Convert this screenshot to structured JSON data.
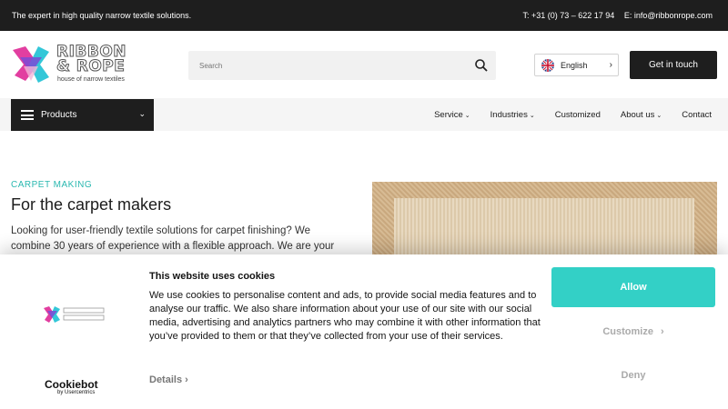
{
  "topbar": {
    "tagline": "The expert in high quality narrow textile solutions.",
    "phone": "T: +31 (0) 73 – 622 17 94",
    "email": "E: info@ribbonrope.com"
  },
  "header": {
    "logo_line1": "RIBBON",
    "logo_line2": "& ROPE",
    "logo_sub": "house of narrow textiles",
    "search_placeholder": "Search",
    "language": "English",
    "cta": "Get in touch"
  },
  "nav": {
    "products": "Products",
    "items": [
      {
        "label": "Service",
        "dropdown": true
      },
      {
        "label": "Industries",
        "dropdown": true
      },
      {
        "label": "Customized",
        "dropdown": false
      },
      {
        "label": "About us",
        "dropdown": true
      },
      {
        "label": "Contact",
        "dropdown": false
      }
    ]
  },
  "hero": {
    "kicker": "CARPET MAKING",
    "title": "For the carpet makers",
    "text": "Looking for user-friendly textile solutions for carpet finishing? We combine 30 years of experience with a flexible approach. We are your"
  },
  "cookie": {
    "title": "This website uses cookies",
    "body": "We use cookies to personalise content and ads, to provide social media features and to analyse our traffic. We also share information about your use of our site with our social media, advertising and analytics partners who may combine it with other information that you’ve provided to them or that they’ve collected from your use of their services.",
    "details": "Details",
    "allow": "Allow",
    "customize": "Customize",
    "deny": "Deny",
    "brand": "Cookiebot",
    "brand_by": "by Usercentrics"
  },
  "colors": {
    "accent": "#33d0c6",
    "dark": "#1e1e1e",
    "kicker": "#2ab8b0"
  }
}
